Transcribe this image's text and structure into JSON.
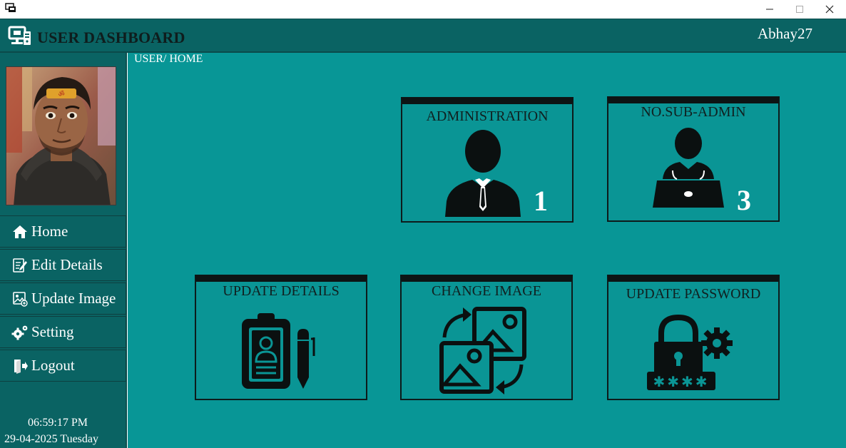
{
  "window": {
    "controls": [
      "minimize-icon",
      "maximize-icon",
      "close-icon"
    ]
  },
  "header": {
    "title": "USER DASHBOARD",
    "username": "Abhay27"
  },
  "breadcrumb": "USER/ HOME",
  "sidebar": {
    "items": [
      {
        "label": "Home",
        "icon": "home-icon"
      },
      {
        "label": "Edit Details",
        "icon": "edit-document-icon"
      },
      {
        "label": "Update Image",
        "icon": "image-edit-icon"
      },
      {
        "label": "Setting",
        "icon": "gears-icon"
      },
      {
        "label": "Logout",
        "icon": "logout-icon"
      }
    ],
    "time": "06:59:17 PM",
    "date": "29-04-2025 Tuesday"
  },
  "cards": [
    {
      "title": "ADMINISTRATION",
      "count": "1",
      "icon": "admin-user-icon"
    },
    {
      "title": "NO.SUB-ADMIN",
      "count": "3",
      "icon": "laptop-user-icon"
    },
    {
      "title": "UPDATE DETAILS",
      "icon": "clipboard-profile-icon"
    },
    {
      "title": "CHANGE IMAGE",
      "icon": "swap-images-icon"
    },
    {
      "title": "UPDATE PASSWORD",
      "icon": "lock-password-icon"
    }
  ],
  "colors": {
    "header": "#0a6363",
    "main": "#089696",
    "sidebar": "#0a6363",
    "card": "#0a9595"
  }
}
